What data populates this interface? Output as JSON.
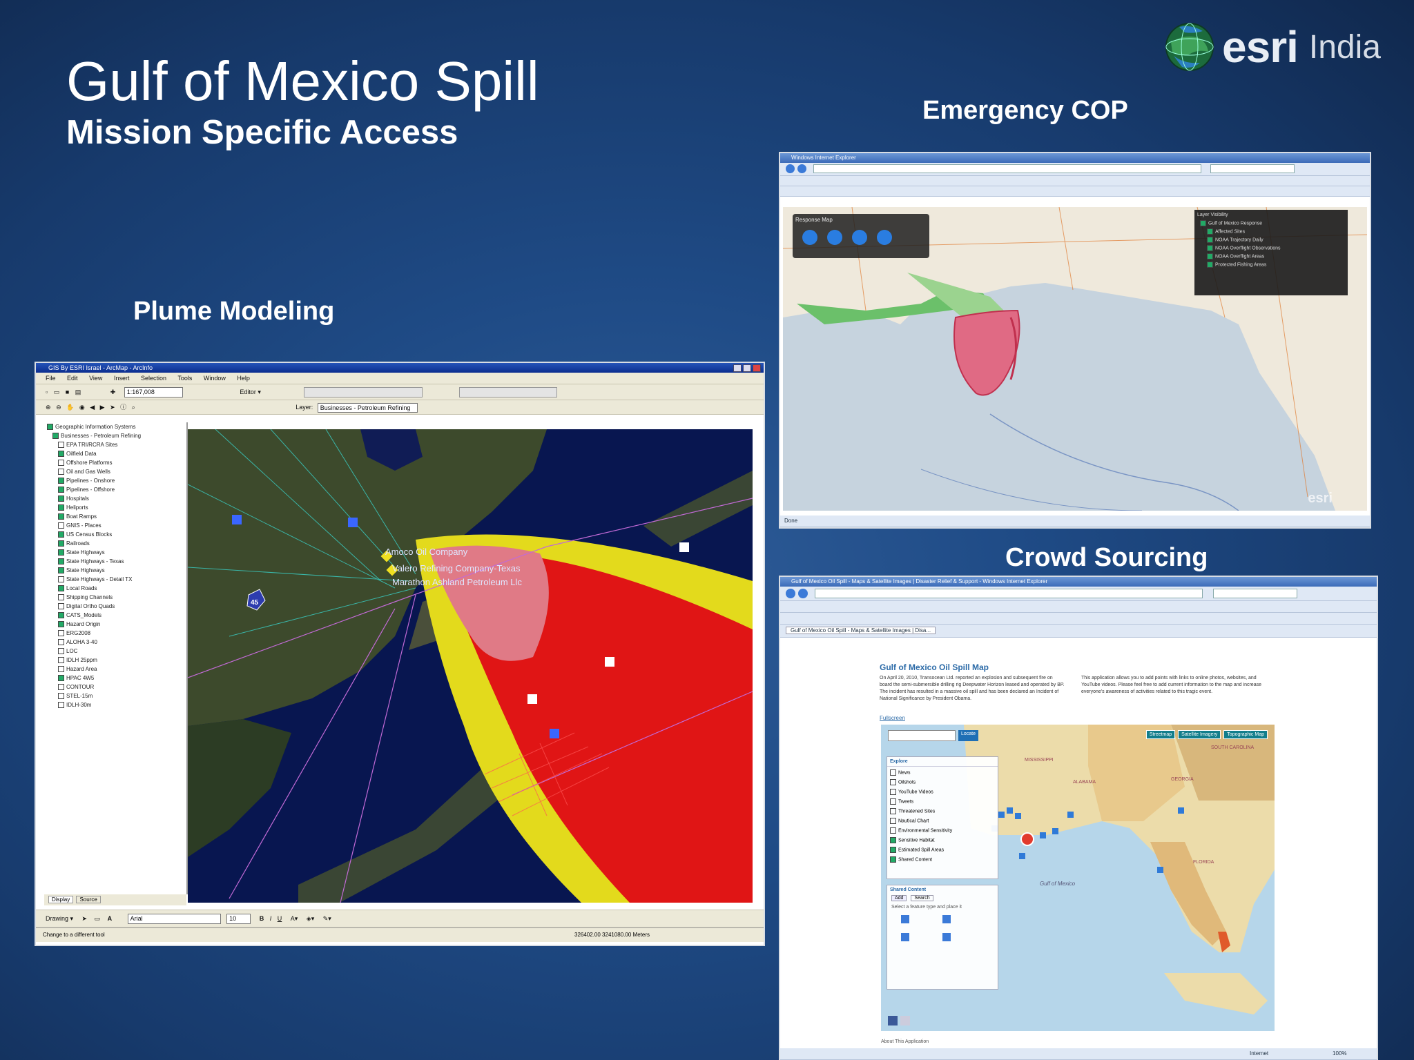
{
  "slide": {
    "title": "Gulf of Mexico Spill",
    "subtitle": "Mission Specific Access"
  },
  "logo": {
    "word": "esri",
    "country": "India",
    "icon": "globe-icon"
  },
  "sections": {
    "plume": "Plume Modeling",
    "cop": "Emergency COP",
    "crowd": "Crowd Sourcing"
  },
  "arcmap": {
    "title": "GIS By ESRI Israel - ArcMap - ArcInfo",
    "menu": [
      "File",
      "Edit",
      "View",
      "Insert",
      "Selection",
      "Tools",
      "Window",
      "Help"
    ],
    "scale": "1:167,008",
    "editor": "Editor ▾",
    "layer_label": "Layer:",
    "layer_value": "Businesses - Petroleum Refining",
    "toc": [
      {
        "text": "Geographic Information Systems",
        "on": true
      },
      {
        "text": "Businesses - Petroleum Refining",
        "on": true
      },
      {
        "text": "EPA TRI/RCRA Sites",
        "on": false
      },
      {
        "text": "Oilfield Data",
        "on": true
      },
      {
        "text": "Offshore Platforms",
        "on": false
      },
      {
        "text": "Oil and Gas Wells",
        "on": false
      },
      {
        "text": "Pipelines - Onshore",
        "on": true
      },
      {
        "text": "Pipelines - Offshore",
        "on": true
      },
      {
        "text": "Hospitals",
        "on": true
      },
      {
        "text": "Heliports",
        "on": true
      },
      {
        "text": "Boat Ramps",
        "on": true
      },
      {
        "text": "GNIS - Places",
        "on": false
      },
      {
        "text": "US Census Blocks",
        "on": true
      },
      {
        "text": "Railroads",
        "on": true
      },
      {
        "text": "State Highways",
        "on": true
      },
      {
        "text": "State Highways - Texas",
        "on": true
      },
      {
        "text": "State Highways",
        "on": true
      },
      {
        "text": "State Highways - Detail TX",
        "on": false
      },
      {
        "text": "Local Roads",
        "on": true
      },
      {
        "text": "Shipping Channels",
        "on": false
      },
      {
        "text": "Digital Ortho Quads",
        "on": false
      },
      {
        "text": "CATS_Models",
        "on": true
      },
      {
        "text": "Hazard Origin",
        "on": true
      },
      {
        "text": "ERG2008",
        "on": false
      },
      {
        "text": "ALOHA 3-40",
        "on": false
      },
      {
        "text": "LOC",
        "on": false
      },
      {
        "text": "IDLH 25ppm",
        "on": false
      },
      {
        "text": "Hazard Area",
        "on": false
      },
      {
        "text": "HPAC 4W5",
        "on": true
      },
      {
        "text": "CONTOUR",
        "on": false
      },
      {
        "text": "STEL-15m",
        "on": false
      },
      {
        "text": "IDLH-30m",
        "on": false
      }
    ],
    "toc_tabs": [
      "Display",
      "Source"
    ],
    "map_labels": [
      "Amoco Oil Company",
      "Valero Refining Company-Texas",
      "Marathon Ashland Petroleum Llc"
    ],
    "interstate": "45",
    "drawing": "Drawing ▾",
    "font": "Arial",
    "font_size": "10",
    "status_left": "Change to a different tool",
    "status_right": "326402.00  3241080.00 Meters"
  },
  "cop": {
    "window_title": "Windows Internet Explorer",
    "panel_title": "Response Map",
    "layer_panel_title": "Layer Visibility",
    "layers": [
      "Gulf of Mexico Response",
      "Affected Sites",
      "NOAA Trajectory Daily",
      "NOAA Overflight Observations",
      "NOAA Overflight Areas",
      "Protected Fishing Areas"
    ],
    "status": "Done",
    "brand": "esri"
  },
  "crowd": {
    "window_title": "Gulf of Mexico Oil Spill - Maps & Satellite Images | Disaster Relief & Support - Windows Internet Explorer",
    "tab_title": "Gulf of Mexico Oil Spill - Maps & Satellite Images | Disa...",
    "page_heading": "Gulf of Mexico Oil Spill Map",
    "intro_left": "On April 20, 2010, Transocean Ltd. reported an explosion and subsequent fire on board the semi-submersible drilling rig Deepwater Horizon leased and operated by BP. The incident has resulted in a massive oil spill and has been declared an Incident of National Significance by President Obama.",
    "intro_right": "This application allows you to add points with links to online photos, websites, and YouTube videos. Please feel free to add current information to the map and increase everyone's awareness of activities related to this tragic event.",
    "fullscreen": "Fullscreen",
    "locate_button": "Locate",
    "map_buttons": [
      "Streetmap",
      "Satellite Imagery",
      "Topographic Map"
    ],
    "explore_title": "Explore",
    "explore_items": [
      {
        "text": "News",
        "on": false
      },
      {
        "text": "Oilshots",
        "on": false
      },
      {
        "text": "YouTube Videos",
        "on": false
      },
      {
        "text": "Tweets",
        "on": false
      },
      {
        "text": "Threatened Sites",
        "on": false
      },
      {
        "text": "Nautical Chart",
        "on": false
      },
      {
        "text": "Environmental Sensitivity",
        "on": false
      },
      {
        "text": "Sensitive Habitat",
        "on": true
      },
      {
        "text": "Estimated Spill Areas",
        "on": true
      },
      {
        "text": "Shared Content",
        "on": true
      }
    ],
    "shared_title": "Shared Content",
    "shared_tabs": [
      "Add",
      "Search"
    ],
    "shared_hint": "Select a feature type and place it",
    "map_place_labels": [
      "Gulf of Mexico",
      "GEORGIA",
      "ALABAMA",
      "FLORIDA",
      "SOUTH CAROLINA",
      "MISSISSIPPI"
    ],
    "footer": "About This Application",
    "status": "Internet",
    "zoom": "100%"
  },
  "colors": {
    "spill_red": "#e01515",
    "spill_yellow": "#e3da1c",
    "spill_pink": "#e07a86",
    "water_dark": "#0a1a55"
  }
}
